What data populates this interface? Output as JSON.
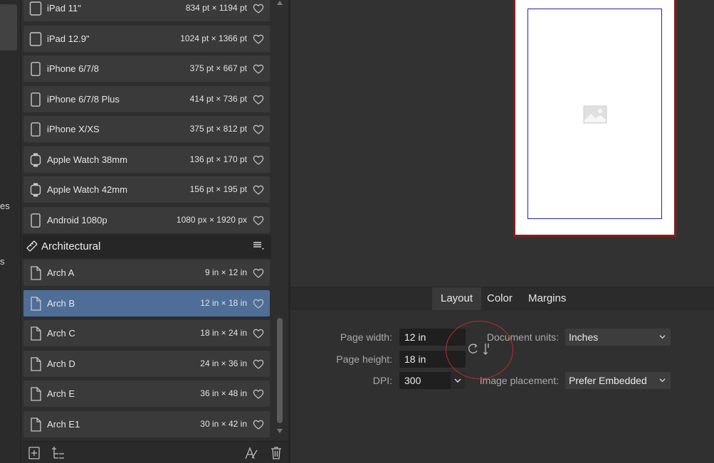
{
  "left_strip": {
    "fragment_1": "es",
    "fragment_2": "s"
  },
  "presets": [
    {
      "label": "iPad 11\"",
      "size": "834 pt × 1194 pt",
      "icon": "tablet-icon",
      "selected": false
    },
    {
      "label": "iPad 12.9\"",
      "size": "1024 pt × 1366 pt",
      "icon": "tablet-icon",
      "selected": false
    },
    {
      "label": "iPhone 6/7/8",
      "size": "375 pt × 667 pt",
      "icon": "phone-icon",
      "selected": false
    },
    {
      "label": "iPhone 6/7/8 Plus",
      "size": "414 pt × 736 pt",
      "icon": "phone-icon",
      "selected": false
    },
    {
      "label": "iPhone X/XS",
      "size": "375 pt × 812 pt",
      "icon": "phone-icon",
      "selected": false
    },
    {
      "label": "Apple Watch 38mm",
      "size": "136 pt × 170 pt",
      "icon": "watch-icon",
      "selected": false
    },
    {
      "label": "Apple Watch 42mm",
      "size": "156 pt × 195 pt",
      "icon": "watch-icon",
      "selected": false
    },
    {
      "label": "Android 1080p",
      "size": "1080 px × 1920 px",
      "icon": "phone-icon",
      "selected": false
    }
  ],
  "category": {
    "label": "Architectural",
    "icon": "ruler-icon"
  },
  "arch_presets": [
    {
      "label": "Arch A",
      "size": "9 in × 12 in",
      "selected": false
    },
    {
      "label": "Arch B",
      "size": "12 in × 18 in",
      "selected": true
    },
    {
      "label": "Arch C",
      "size": "18 in × 24 in",
      "selected": false
    },
    {
      "label": "Arch D",
      "size": "24 in × 36 in",
      "selected": false
    },
    {
      "label": "Arch E",
      "size": "36 in × 48 in",
      "selected": false
    },
    {
      "label": "Arch E1",
      "size": "30 in × 42 in",
      "selected": false
    }
  ],
  "tabs": [
    "Layout",
    "Color",
    "Margins"
  ],
  "active_tab": "Layout",
  "layout": {
    "page_width_label": "Page width:",
    "page_width_value": "12 in",
    "page_height_label": "Page height:",
    "page_height_value": "18 in",
    "dpi_label": "DPI:",
    "dpi_value": "300",
    "document_units_label": "Document units:",
    "document_units_value": "Inches",
    "image_placement_label": "Image placement:",
    "image_placement_value": "Prefer Embedded"
  },
  "colors": {
    "selected_row": "#4e6e98",
    "page_border": "#8a1c1c",
    "margin_guide": "#2323a6",
    "annotation": "#c0282c"
  }
}
